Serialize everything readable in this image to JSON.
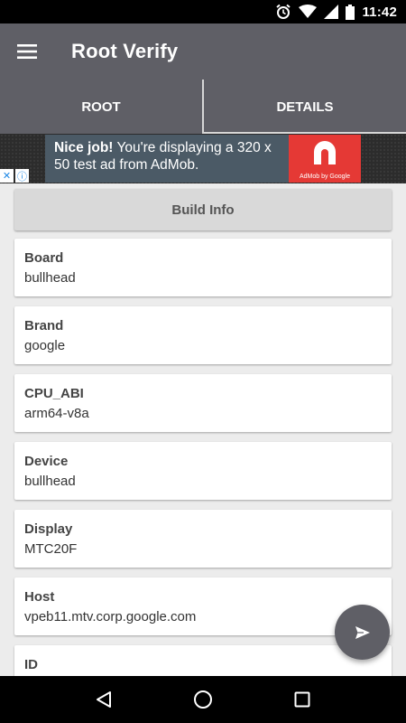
{
  "status_bar": {
    "time": "11:42",
    "icons": [
      "alarm-icon",
      "wifi-icon",
      "signal-icon",
      "battery-icon"
    ]
  },
  "toolbar": {
    "title": "Root Verify",
    "menu_icon": "hamburger-menu-icon"
  },
  "tabs": [
    {
      "label": "ROOT",
      "active": false
    },
    {
      "label": "DETAILS",
      "active": true
    }
  ],
  "ad": {
    "headline": "Nice job!",
    "body": " You're displaying a 320 x 50 test ad from AdMob.",
    "logo_caption": "AdMob by Google",
    "adchoices_icons": [
      "close-x-icon",
      "info-icon"
    ]
  },
  "section": {
    "title": "Build Info"
  },
  "items": [
    {
      "label": "Board",
      "value": "bullhead"
    },
    {
      "label": "Brand",
      "value": "google"
    },
    {
      "label": "CPU_ABI",
      "value": "arm64-v8a"
    },
    {
      "label": "Device",
      "value": "bullhead"
    },
    {
      "label": "Display",
      "value": "MTC20F"
    },
    {
      "label": "Host",
      "value": "vpeb11.mtv.corp.google.com"
    },
    {
      "label": "ID",
      "value": ""
    }
  ],
  "fab": {
    "icon": "send-icon"
  },
  "nav_bar": {
    "icons": [
      "back-icon",
      "home-icon",
      "recents-icon"
    ]
  },
  "colors": {
    "primary": "#5f5f66",
    "background": "#ececec",
    "ad_banner": "#4b5a66",
    "ad_logo": "#e53935"
  }
}
